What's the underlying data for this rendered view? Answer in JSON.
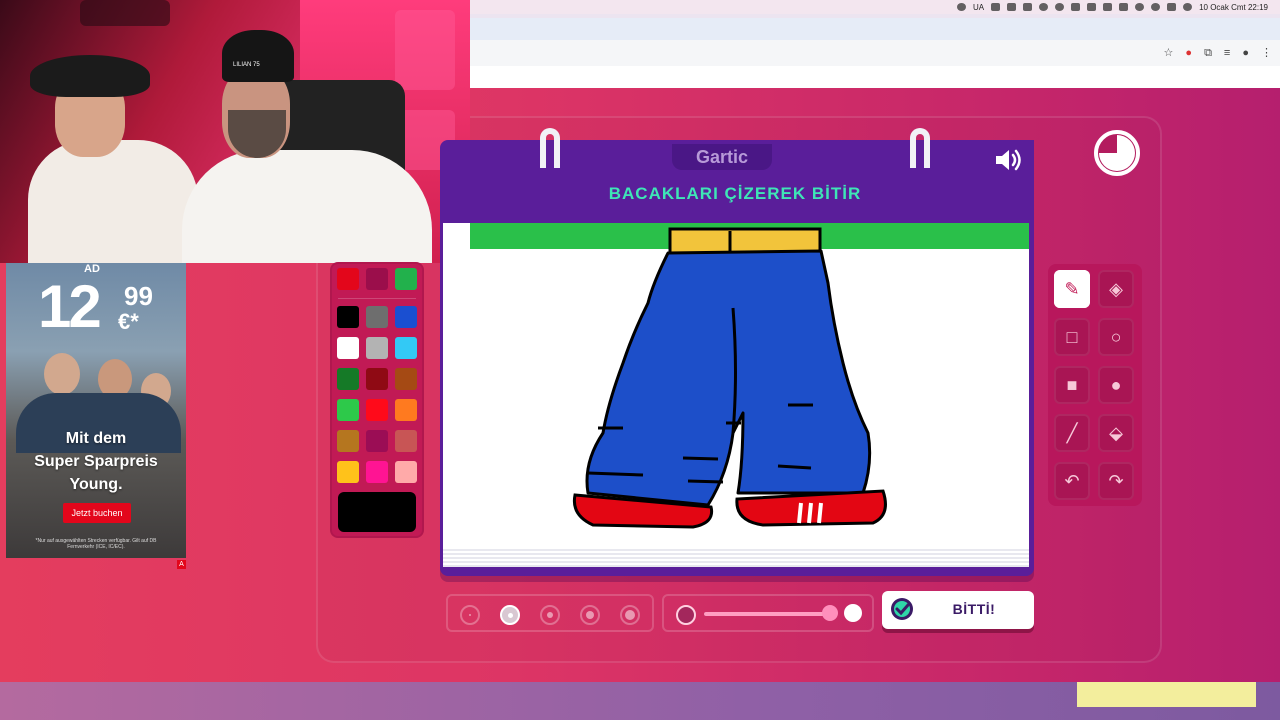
{
  "menubar": {
    "input_source": "UA",
    "datetime": "10 Ocak Cmt  22:19",
    "icons": [
      "cloud-icon",
      "keyboard-icon",
      "cast-icon",
      "hdr-icon",
      "battery-icon",
      "play-icon",
      "volume-icon",
      "bluetooth-icon",
      "eject-icon",
      "wifi-icon",
      "user-icon",
      "search-icon",
      "control-center-icon",
      "siri-icon"
    ]
  },
  "browser": {
    "toolbar_icons": [
      "bookmark-star-icon",
      "extension-icon",
      "puzzle-icon",
      "media-icon",
      "profile-icon",
      "menu-icon"
    ]
  },
  "webcam": {
    "hat_text": "LILIAN 75"
  },
  "ad": {
    "label": "AD",
    "price_main": "12",
    "price_cents": "99",
    "price_currency": "€*",
    "headline_lines": [
      "Mit dem",
      "Super Sparpreis",
      "Young."
    ],
    "button_label": "Jetzt buchen",
    "fine_print": "*Nur auf ausgewählten Strecken verfügbar. Gilt auf DB Fernverkehr (ICE, IC/EC).",
    "marker": "A"
  },
  "game": {
    "logo": "Gartic",
    "title": "BACAKLARI ÇİZEREK BİTİR",
    "done_label": "BİTTİ!",
    "selected_tool": "pencil",
    "selected_color": "#000000",
    "brush_size_selected_index": 1,
    "opacity_level": 1.0,
    "palette": [
      "#e3061b",
      "#9b0e4b",
      "#22b14c",
      "#000000",
      "#6e6e6e",
      "#1a4fd1",
      "#ffffff",
      "#b3b3b3",
      "#33c9f5",
      "#157a27",
      "#8f0a14",
      "#a54a14",
      "#2dc94a",
      "#ff0a1a",
      "#ff7a1f",
      "#b5761f",
      "#9b0d55",
      "#c85555",
      "#ffc21a",
      "#ff1493",
      "#ffaaa9"
    ],
    "tools": [
      {
        "name": "pencil",
        "icon": "pencil-icon"
      },
      {
        "name": "eraser",
        "icon": "eraser-icon"
      },
      {
        "name": "rectangle-outline",
        "icon": "square-outline-icon"
      },
      {
        "name": "ellipse-outline",
        "icon": "circle-outline-icon"
      },
      {
        "name": "rectangle-filled",
        "icon": "square-filled-icon"
      },
      {
        "name": "ellipse-filled",
        "icon": "circle-filled-icon"
      },
      {
        "name": "line",
        "icon": "line-icon"
      },
      {
        "name": "fill",
        "icon": "paint-bucket-icon"
      },
      {
        "name": "undo",
        "icon": "undo-icon"
      },
      {
        "name": "redo",
        "icon": "redo-icon"
      }
    ]
  }
}
